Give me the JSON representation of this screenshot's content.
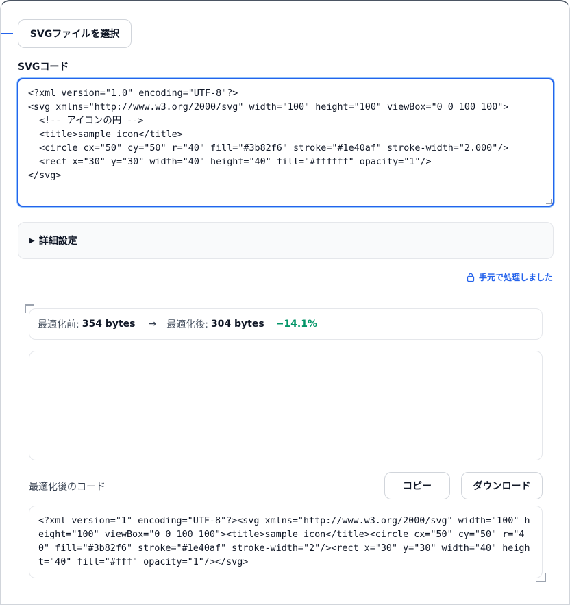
{
  "file_select": {
    "label": "SVGファイルを選択"
  },
  "svg_code": {
    "label": "SVGコード",
    "value": "<?xml version=\"1.0\" encoding=\"UTF-8\"?>\n<svg xmlns=\"http://www.w3.org/2000/svg\" width=\"100\" height=\"100\" viewBox=\"0 0 100 100\">\n  <!-- アイコンの円 -->\n  <title>sample icon</title>\n  <circle cx=\"50\" cy=\"50\" r=\"40\" fill=\"#3b82f6\" stroke=\"#1e40af\" stroke-width=\"2.000\"/>\n  <rect x=\"30\" y=\"30\" width=\"40\" height=\"40\" fill=\"#ffffff\" opacity=\"1\"/>\n</svg>"
  },
  "advanced": {
    "label": "詳細設定",
    "icon": "triangle-right-icon"
  },
  "local_note": {
    "label": "手元で処理しました",
    "icon": "lock-icon"
  },
  "stats": {
    "before_label": "最適化前:",
    "before_value": "354 bytes",
    "arrow": "→",
    "after_label": "最適化後:",
    "after_value": "304 bytes",
    "change": "−14.1%"
  },
  "output": {
    "label": "最適化後のコード",
    "copy_label": "コピー",
    "download_label": "ダウンロード",
    "code": "<?xml version=\"1\" encoding=\"UTF-8\"?><svg xmlns=\"http://www.w3.org/2000/svg\" width=\"100\" height=\"100\" viewBox=\"0 0 100 100\"><title>sample icon</title><circle cx=\"50\" cy=\"50\" r=\"40\" fill=\"#3b82f6\" stroke=\"#1e40af\" stroke-width=\"2\"/><rect x=\"30\" y=\"30\" width=\"40\" height=\"40\" fill=\"#fff\" opacity=\"1\"/></svg>"
  },
  "colors": {
    "accent": "#2563eb",
    "success": "#059669",
    "border": "#e5e7eb"
  }
}
